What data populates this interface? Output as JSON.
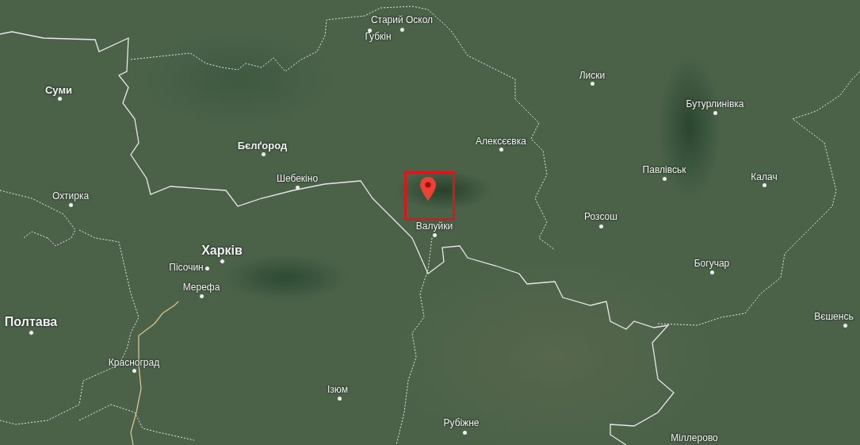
{
  "map": {
    "labels": [
      {
        "text": "Старий Оскол",
        "kind": "town"
      },
      {
        "text": "Губкін",
        "kind": "town"
      },
      {
        "text": "Суми",
        "kind": "city"
      },
      {
        "text": "Бєлґород",
        "kind": "city"
      },
      {
        "text": "Шебекіно",
        "kind": "town"
      },
      {
        "text": "Охтирка",
        "kind": "town"
      },
      {
        "text": "Лиски",
        "kind": "town"
      },
      {
        "text": "Алексєєвка",
        "kind": "town"
      },
      {
        "text": "Бутурлинівка",
        "kind": "town"
      },
      {
        "text": "Павлівськ",
        "kind": "town"
      },
      {
        "text": "Калач",
        "kind": "town"
      },
      {
        "text": "Валуйки",
        "kind": "town"
      },
      {
        "text": "Розсош",
        "kind": "town"
      },
      {
        "text": "Харків",
        "kind": "major"
      },
      {
        "text": "Пісочин",
        "kind": "town"
      },
      {
        "text": "Мерефа",
        "kind": "town"
      },
      {
        "text": "Полтава",
        "kind": "major"
      },
      {
        "text": "Красноград",
        "kind": "town"
      },
      {
        "text": "Ізюм",
        "kind": "town"
      },
      {
        "text": "Богучар",
        "kind": "town"
      },
      {
        "text": "Вєшенсь",
        "kind": "town"
      },
      {
        "text": "Рубіжне",
        "kind": "town"
      },
      {
        "text": "Міллерово",
        "kind": "town"
      }
    ]
  }
}
